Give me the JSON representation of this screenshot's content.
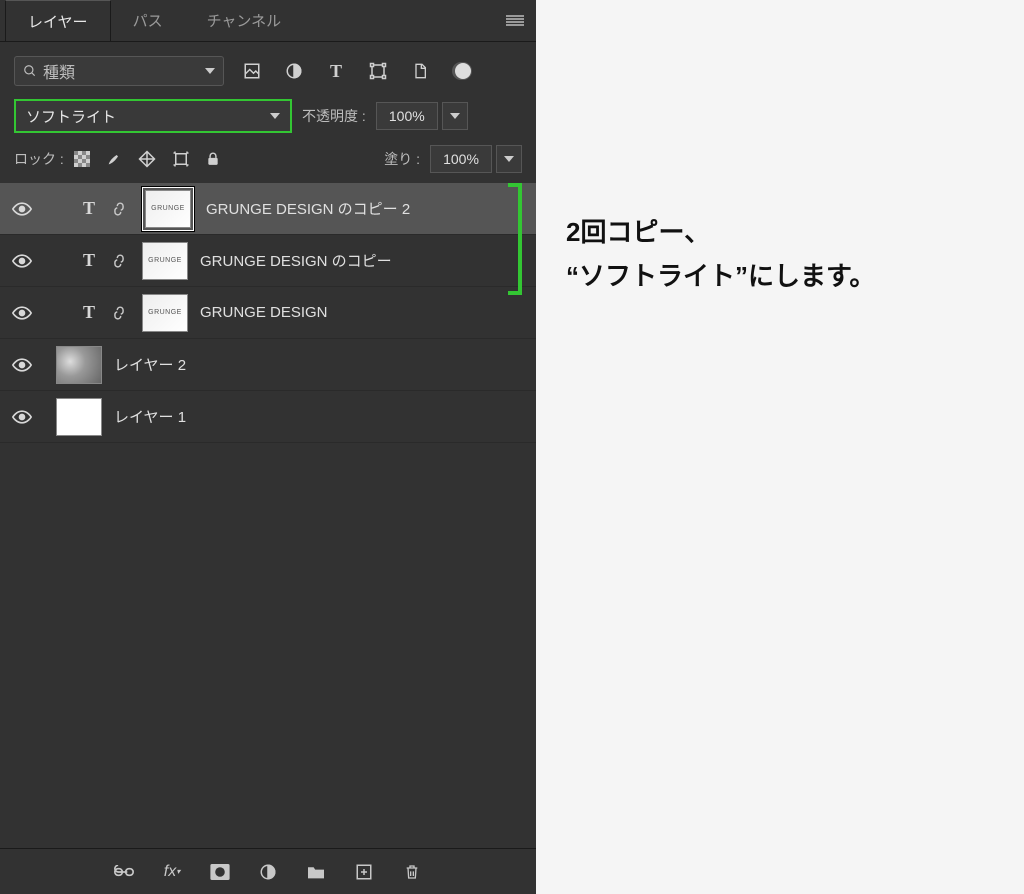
{
  "tabs": {
    "layers": "レイヤー",
    "paths": "パス",
    "channels": "チャンネル"
  },
  "filter": {
    "search_placeholder": "種類"
  },
  "blend": {
    "mode": "ソフトライト",
    "opacity_label": "不透明度 :",
    "opacity_value": "100%"
  },
  "lock": {
    "label": "ロック :",
    "fill_label": "塗り :",
    "fill_value": "100%"
  },
  "layers": [
    {
      "name": "GRUNGE DESIGN のコピー 2",
      "type": "text",
      "selected": true,
      "linked": true
    },
    {
      "name": "GRUNGE DESIGN のコピー",
      "type": "text",
      "selected": false,
      "linked": true
    },
    {
      "name": "GRUNGE DESIGN",
      "type": "text",
      "selected": false,
      "linked": true
    },
    {
      "name": "レイヤー 2",
      "type": "image",
      "selected": false,
      "linked": false
    },
    {
      "name": "レイヤー 1",
      "type": "plain",
      "selected": false,
      "linked": false
    }
  ],
  "annotation": {
    "line1": "2回コピー、",
    "line2": "“ソフトライト”にします。"
  },
  "bottom_icons": [
    "link",
    "fx",
    "mask",
    "adjust",
    "group",
    "new",
    "trash"
  ]
}
